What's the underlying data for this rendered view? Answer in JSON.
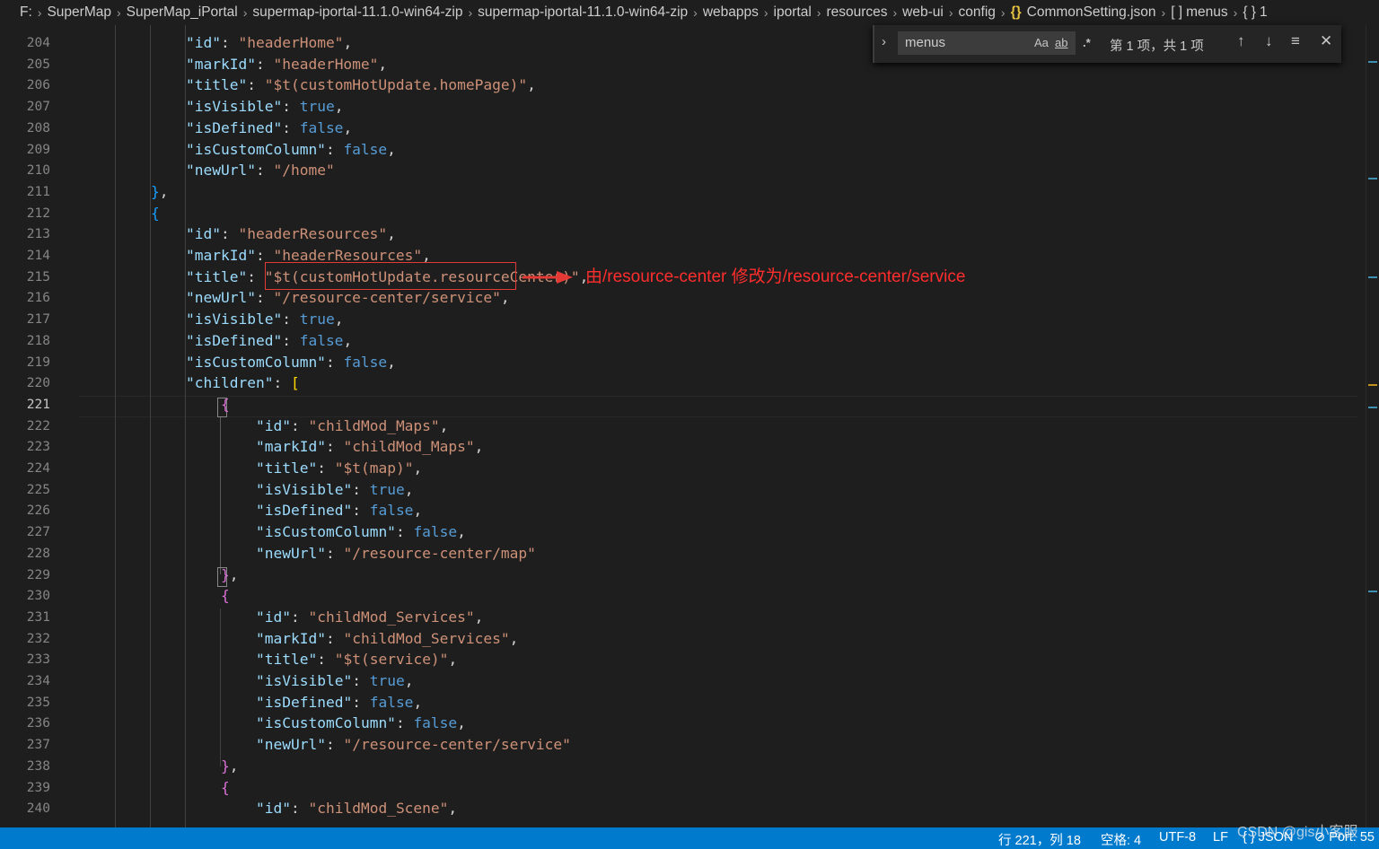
{
  "breadcrumb": [
    "F:",
    "SuperMap",
    "SuperMap_iPortal",
    "supermap-iportal-11.1.0-win64-zip",
    "supermap-iportal-11.1.0-win64-zip",
    "webapps",
    "iportal",
    "resources",
    "web-ui",
    "config",
    "CommonSetting.json",
    "menus",
    "1"
  ],
  "breadcrumb_icons": {
    "file": "json-braces-icon",
    "array": "array-brackets-icon",
    "object": "object-braces-icon"
  },
  "lines": [
    {
      "n": "204",
      "indent": 3,
      "parts": [
        [
          "k",
          "\"id\""
        ],
        [
          "p",
          ": "
        ],
        [
          "s",
          "\"headerHome\""
        ],
        [
          "p",
          ","
        ]
      ]
    },
    {
      "n": "205",
      "indent": 3,
      "parts": [
        [
          "k",
          "\"markId\""
        ],
        [
          "p",
          ": "
        ],
        [
          "s",
          "\"headerHome\""
        ],
        [
          "p",
          ","
        ]
      ]
    },
    {
      "n": "206",
      "indent": 3,
      "parts": [
        [
          "k",
          "\"title\""
        ],
        [
          "p",
          ": "
        ],
        [
          "s",
          "\"$t(customHotUpdate.homePage)\""
        ],
        [
          "p",
          ","
        ]
      ]
    },
    {
      "n": "207",
      "indent": 3,
      "parts": [
        [
          "k",
          "\"isVisible\""
        ],
        [
          "p",
          ": "
        ],
        [
          "b",
          "true"
        ],
        [
          "p",
          ","
        ]
      ]
    },
    {
      "n": "208",
      "indent": 3,
      "parts": [
        [
          "k",
          "\"isDefined\""
        ],
        [
          "p",
          ": "
        ],
        [
          "b",
          "false"
        ],
        [
          "p",
          ","
        ]
      ]
    },
    {
      "n": "209",
      "indent": 3,
      "parts": [
        [
          "k",
          "\"isCustomColumn\""
        ],
        [
          "p",
          ": "
        ],
        [
          "b",
          "false"
        ],
        [
          "p",
          ","
        ]
      ]
    },
    {
      "n": "210",
      "indent": 3,
      "parts": [
        [
          "k",
          "\"newUrl\""
        ],
        [
          "p",
          ": "
        ],
        [
          "s",
          "\"/home\""
        ]
      ]
    },
    {
      "n": "211",
      "indent": 2,
      "parts": [
        [
          "br1",
          "}"
        ],
        [
          "p",
          ","
        ]
      ]
    },
    {
      "n": "212",
      "indent": 2,
      "parts": [
        [
          "br1",
          "{"
        ]
      ]
    },
    {
      "n": "213",
      "indent": 3,
      "parts": [
        [
          "k",
          "\"id\""
        ],
        [
          "p",
          ": "
        ],
        [
          "s",
          "\"headerResources\""
        ],
        [
          "p",
          ","
        ]
      ]
    },
    {
      "n": "214",
      "indent": 3,
      "parts": [
        [
          "k",
          "\"markId\""
        ],
        [
          "p",
          ": "
        ],
        [
          "s",
          "\"headerResources\""
        ],
        [
          "p",
          ","
        ]
      ]
    },
    {
      "n": "215",
      "indent": 3,
      "parts": [
        [
          "k",
          "\"title\""
        ],
        [
          "p",
          ": "
        ],
        [
          "s",
          "\"$t(customHotUpdate.resourceCenter)\""
        ],
        [
          "p",
          ","
        ]
      ]
    },
    {
      "n": "216",
      "indent": 3,
      "parts": [
        [
          "k",
          "\"newUrl\""
        ],
        [
          "p",
          ": "
        ],
        [
          "s",
          "\"/resource-center/service\""
        ],
        [
          "p",
          ","
        ]
      ]
    },
    {
      "n": "217",
      "indent": 3,
      "parts": [
        [
          "k",
          "\"isVisible\""
        ],
        [
          "p",
          ": "
        ],
        [
          "b",
          "true"
        ],
        [
          "p",
          ","
        ]
      ]
    },
    {
      "n": "218",
      "indent": 3,
      "parts": [
        [
          "k",
          "\"isDefined\""
        ],
        [
          "p",
          ": "
        ],
        [
          "b",
          "false"
        ],
        [
          "p",
          ","
        ]
      ]
    },
    {
      "n": "219",
      "indent": 3,
      "parts": [
        [
          "k",
          "\"isCustomColumn\""
        ],
        [
          "p",
          ": "
        ],
        [
          "b",
          "false"
        ],
        [
          "p",
          ","
        ]
      ]
    },
    {
      "n": "220",
      "indent": 3,
      "parts": [
        [
          "k",
          "\"children\""
        ],
        [
          "p",
          ": "
        ],
        [
          "br3",
          "["
        ]
      ]
    },
    {
      "n": "221",
      "indent": 4,
      "active": true,
      "parts": [
        [
          "br2",
          "{"
        ]
      ]
    },
    {
      "n": "222",
      "indent": 5,
      "parts": [
        [
          "k",
          "\"id\""
        ],
        [
          "p",
          ": "
        ],
        [
          "s",
          "\"childMod_Maps\""
        ],
        [
          "p",
          ","
        ]
      ]
    },
    {
      "n": "223",
      "indent": 5,
      "parts": [
        [
          "k",
          "\"markId\""
        ],
        [
          "p",
          ": "
        ],
        [
          "s",
          "\"childMod_Maps\""
        ],
        [
          "p",
          ","
        ]
      ]
    },
    {
      "n": "224",
      "indent": 5,
      "parts": [
        [
          "k",
          "\"title\""
        ],
        [
          "p",
          ": "
        ],
        [
          "s",
          "\"$t(map)\""
        ],
        [
          "p",
          ","
        ]
      ]
    },
    {
      "n": "225",
      "indent": 5,
      "parts": [
        [
          "k",
          "\"isVisible\""
        ],
        [
          "p",
          ": "
        ],
        [
          "b",
          "true"
        ],
        [
          "p",
          ","
        ]
      ]
    },
    {
      "n": "226",
      "indent": 5,
      "parts": [
        [
          "k",
          "\"isDefined\""
        ],
        [
          "p",
          ": "
        ],
        [
          "b",
          "false"
        ],
        [
          "p",
          ","
        ]
      ]
    },
    {
      "n": "227",
      "indent": 5,
      "parts": [
        [
          "k",
          "\"isCustomColumn\""
        ],
        [
          "p",
          ": "
        ],
        [
          "b",
          "false"
        ],
        [
          "p",
          ","
        ]
      ]
    },
    {
      "n": "228",
      "indent": 5,
      "parts": [
        [
          "k",
          "\"newUrl\""
        ],
        [
          "p",
          ": "
        ],
        [
          "s",
          "\"/resource-center/map\""
        ]
      ]
    },
    {
      "n": "229",
      "indent": 4,
      "parts": [
        [
          "br2",
          "}"
        ],
        [
          "p",
          ","
        ]
      ]
    },
    {
      "n": "230",
      "indent": 4,
      "parts": [
        [
          "br2",
          "{"
        ]
      ]
    },
    {
      "n": "231",
      "indent": 5,
      "parts": [
        [
          "k",
          "\"id\""
        ],
        [
          "p",
          ": "
        ],
        [
          "s",
          "\"childMod_Services\""
        ],
        [
          "p",
          ","
        ]
      ]
    },
    {
      "n": "232",
      "indent": 5,
      "parts": [
        [
          "k",
          "\"markId\""
        ],
        [
          "p",
          ": "
        ],
        [
          "s",
          "\"childMod_Services\""
        ],
        [
          "p",
          ","
        ]
      ]
    },
    {
      "n": "233",
      "indent": 5,
      "parts": [
        [
          "k",
          "\"title\""
        ],
        [
          "p",
          ": "
        ],
        [
          "s",
          "\"$t(service)\""
        ],
        [
          "p",
          ","
        ]
      ]
    },
    {
      "n": "234",
      "indent": 5,
      "parts": [
        [
          "k",
          "\"isVisible\""
        ],
        [
          "p",
          ": "
        ],
        [
          "b",
          "true"
        ],
        [
          "p",
          ","
        ]
      ]
    },
    {
      "n": "235",
      "indent": 5,
      "parts": [
        [
          "k",
          "\"isDefined\""
        ],
        [
          "p",
          ": "
        ],
        [
          "b",
          "false"
        ],
        [
          "p",
          ","
        ]
      ]
    },
    {
      "n": "236",
      "indent": 5,
      "parts": [
        [
          "k",
          "\"isCustomColumn\""
        ],
        [
          "p",
          ": "
        ],
        [
          "b",
          "false"
        ],
        [
          "p",
          ","
        ]
      ]
    },
    {
      "n": "237",
      "indent": 5,
      "parts": [
        [
          "k",
          "\"newUrl\""
        ],
        [
          "p",
          ": "
        ],
        [
          "s",
          "\"/resource-center/service\""
        ]
      ]
    },
    {
      "n": "238",
      "indent": 4,
      "parts": [
        [
          "br2",
          "}"
        ],
        [
          "p",
          ","
        ]
      ]
    },
    {
      "n": "239",
      "indent": 4,
      "parts": [
        [
          "br2",
          "{"
        ]
      ]
    },
    {
      "n": "240",
      "indent": 5,
      "parts": [
        [
          "k",
          "\"id\""
        ],
        [
          "p",
          ": "
        ],
        [
          "s",
          "\"childMod_Scene\""
        ],
        [
          "p",
          ","
        ]
      ]
    }
  ],
  "annotation": {
    "text": "由/resource-center 修改为/resource-center/service",
    "color": "#ff2d2d"
  },
  "find": {
    "query": "menus",
    "match_case": "Aa",
    "whole_word": "ab",
    "regex": ".*",
    "result": "第 1 项，共 1 项"
  },
  "status": {
    "position": "行 221，列 18",
    "indent": "空格: 4",
    "encoding": "UTF-8",
    "eol": "LF",
    "language": "JSON",
    "port": "Port: 55"
  },
  "watermark": "CSDN @gis小客服",
  "colors": {
    "accent": "#007acc",
    "editor_bg": "#1e1e1e",
    "key": "#9cdcfe",
    "string": "#ce9178",
    "boolean": "#569cd6"
  }
}
